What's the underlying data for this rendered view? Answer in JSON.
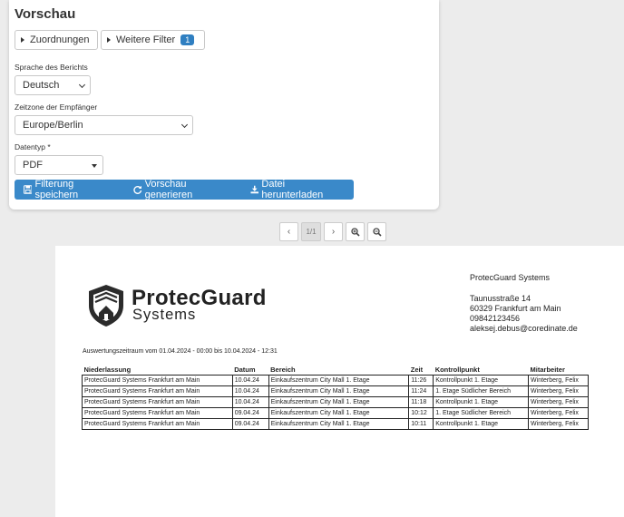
{
  "card": {
    "title": "Vorschau",
    "filters": {
      "assignments_label": "Zuordnungen",
      "more_label": "Weitere Filter",
      "more_count": "1"
    },
    "language": {
      "label": "Sprache des Berichts",
      "value": "Deutsch"
    },
    "timezone": {
      "label": "Zeitzone der Empfänger",
      "value": "Europe/Berlin"
    },
    "datatype": {
      "label": "Datentyp *",
      "value": "PDF"
    },
    "actions": {
      "save_label": "Filterung speichern",
      "generate_label": "Vorschau generieren",
      "download_label": "Datei herunterladen"
    }
  },
  "pager": {
    "prev": "‹",
    "page": "1/1",
    "next": "›"
  },
  "report": {
    "brand_main": "ProtecGuard",
    "brand_sub": "Systems",
    "company": {
      "name": "ProtecGuard Systems",
      "street": "Taunusstraße 14",
      "city": "60329 Frankfurt am Main",
      "phone": "09842123456",
      "email": "aleksej.debus@coredinate.de"
    },
    "period": "Auswertungszeitraum vom 01.04.2024 - 00:00 bis 10.04.2024 - 12:31",
    "columns": [
      "Niederlassung",
      "Datum",
      "Bereich",
      "Zeit",
      "Kontrollpunkt",
      "Mitarbeiter"
    ],
    "rows": [
      [
        "ProtecGuard Systems Frankfurt am Main",
        "10.04.24",
        "Einkaufszentrum City Mall 1. Etage",
        "11:26",
        "Kontrollpunkt 1. Etage",
        "Winterberg, Felix"
      ],
      [
        "ProtecGuard Systems Frankfurt am Main",
        "10.04.24",
        "Einkaufszentrum City Mall 1. Etage",
        "11:24",
        "1. Etage Südlicher Bereich",
        "Winterberg, Felix"
      ],
      [
        "ProtecGuard Systems Frankfurt am Main",
        "10.04.24",
        "Einkaufszentrum City Mall 1. Etage",
        "11:18",
        "Kontrollpunkt 1. Etage",
        "Winterberg, Felix"
      ],
      [
        "ProtecGuard Systems Frankfurt am Main",
        "09.04.24",
        "Einkaufszentrum City Mall 1. Etage",
        "10:12",
        "1. Etage Südlicher Bereich",
        "Winterberg, Felix"
      ],
      [
        "ProtecGuard Systems Frankfurt am Main",
        "09.04.24",
        "Einkaufszentrum City Mall 1. Etage",
        "10:11",
        "Kontrollpunkt 1. Etage",
        "Winterberg, Felix"
      ]
    ]
  },
  "colors": {
    "primary": "#3a89c9",
    "badge": "#2f7fc1"
  },
  "icons": [
    "caret-right-icon",
    "save-icon",
    "refresh-icon",
    "download-icon",
    "chevron-left-icon",
    "chevron-right-icon",
    "zoom-in-icon",
    "zoom-out-icon",
    "shield-house-logo"
  ]
}
